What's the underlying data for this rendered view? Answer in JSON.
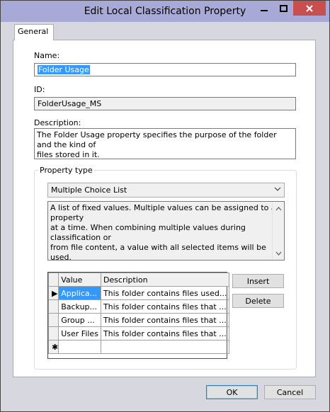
{
  "window": {
    "title": "Edit Local Classification Property"
  },
  "tabs": [
    {
      "label": "General"
    }
  ],
  "name": {
    "label": "Name:",
    "value": "Folder Usage"
  },
  "id": {
    "label": "ID:",
    "value": "FolderUsage_MS"
  },
  "description": {
    "label": "Description:",
    "line1": "The Folder Usage property specifies the purpose of the folder and the kind of",
    "line2": "files stored in it."
  },
  "property_type": {
    "group_label": "Property type",
    "selected": "Multiple Choice List",
    "help_line1": "A list of fixed values. Multiple values can be assigned to a property",
    "help_line2": "at a time. When combining multiple values during classification or",
    "help_line3": "from file content, a value with all selected items will be used."
  },
  "values_grid": {
    "columns": [
      "Value",
      "Description"
    ],
    "rows": [
      {
        "indicator": "▶",
        "value": "Applica...",
        "description": "This folder contains files used..."
      },
      {
        "indicator": "",
        "value": "Backup...",
        "description": "This folder contains files that ..."
      },
      {
        "indicator": "",
        "value": "Group ...",
        "description": "This folder contains files that ..."
      },
      {
        "indicator": "",
        "value": "User Files",
        "description": "This folder contains files that ..."
      }
    ],
    "new_row_marker": "✱"
  },
  "buttons": {
    "insert": "Insert",
    "delete": "Delete",
    "ok": "OK",
    "cancel": "Cancel"
  },
  "colors": {
    "titlebar": "#a9a9d8",
    "close": "#c7504f",
    "selection": "#3399ff"
  }
}
